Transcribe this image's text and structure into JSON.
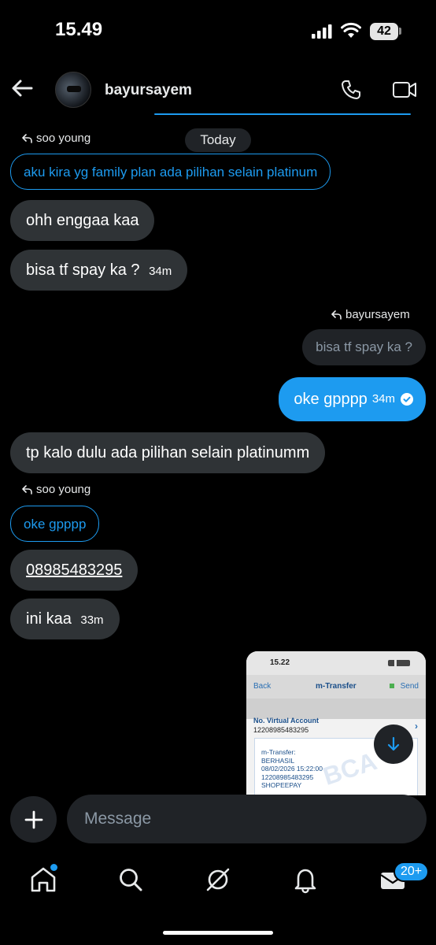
{
  "status_bar": {
    "time": "15.49",
    "battery": "42"
  },
  "header": {
    "contact_name": "bayursayem"
  },
  "chat": {
    "date_label": "Today",
    "messages": [
      {
        "reply_to": "soo young",
        "quote": "aku kira yg family plan ada pilihan selain platinum"
      },
      {
        "text": "ohh enggaa kaa"
      },
      {
        "text": "bisa tf spay ka ?",
        "time": "34m"
      },
      {
        "reply_to": "bayursayem",
        "quote": "bisa tf spay ka ?"
      },
      {
        "text": "oke gpppp",
        "time": "34m"
      },
      {
        "text": "tp kalo dulu ada pilihan selain platinumm"
      },
      {
        "reply_to": "soo young",
        "quote": "oke gpppp"
      },
      {
        "text": "08985483295"
      },
      {
        "text": "ini kaa",
        "time": "33m"
      }
    ],
    "attachment": {
      "time": "15.22",
      "back": "Back",
      "title": "m-Transfer",
      "send": "Send",
      "field_label": "No. Virtual Account",
      "field_value": "12208985483295",
      "receipt_lines": [
        "m-Transfer:",
        "BERHASIL",
        "08/02/2026 15:22:00",
        "12208985483295",
        "SHOPEEPAY"
      ],
      "watermark": "BCA"
    }
  },
  "composer": {
    "placeholder": "Message"
  },
  "tab_bar": {
    "badge": "20+"
  },
  "colors": {
    "accent": "#1d9bf0",
    "bubble_in": "#2f3336",
    "surface": "#202327"
  }
}
